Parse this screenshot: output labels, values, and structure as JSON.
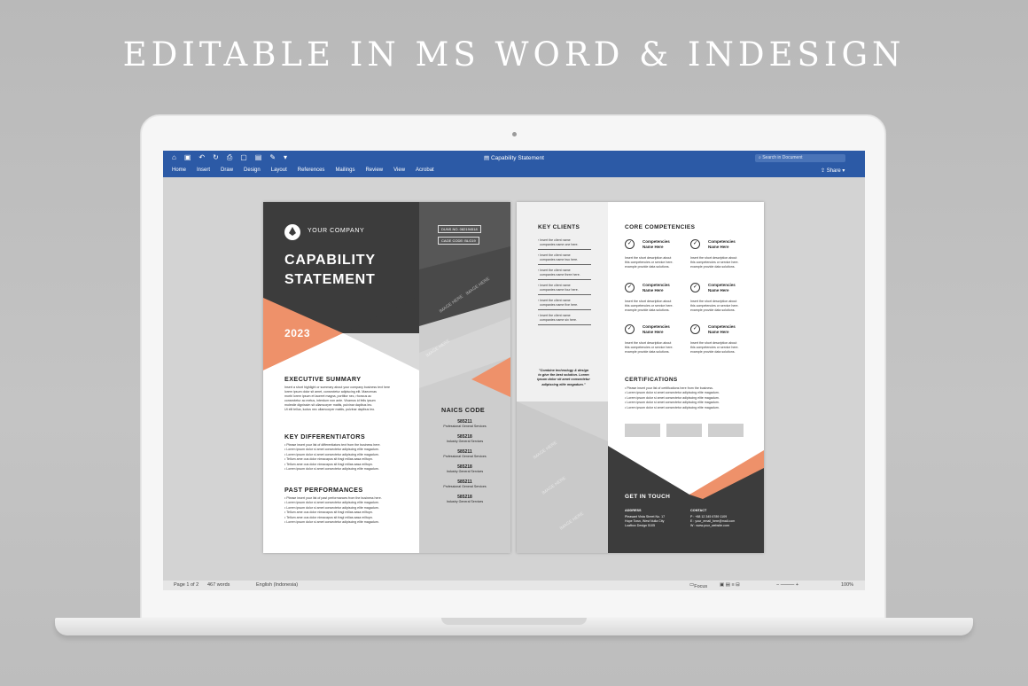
{
  "headline": "EDITABLE IN MS WORD & INDESIGN",
  "app": {
    "title": "Capability Statement",
    "search_placeholder": "Search in Document",
    "tabs": [
      "Home",
      "Insert",
      "Draw",
      "Design",
      "Layout",
      "References",
      "Mailings",
      "Review",
      "View",
      "Acrobat"
    ],
    "share_label": "Share",
    "quick_icons": [
      "home-icon",
      "save-icon",
      "undo-icon",
      "redo-icon",
      "print-icon",
      "new-doc-icon",
      "template-icon",
      "edit-icon",
      "more-icon"
    ]
  },
  "status": {
    "page": "Page 1 of 2",
    "words": "467 words",
    "language": "English (Indonesia)",
    "focus": "Focus",
    "zoom": "100%"
  },
  "page1": {
    "company": "YOUR COMPANY",
    "title_line1": "CAPABILITY",
    "title_line2": "STATEMENT",
    "year": "2023",
    "duns": "DUNS NO. 082194518",
    "cage": "CAGE CODE: BLG19",
    "exec_title": "EXECUTIVE SUMMARY",
    "exec_text": [
      "Insert a short highlight or summary about your company business text here",
      "lorem ipsum dolor sit amet, consectetur adipiscing elit. Maecenas",
      "morbi lorem ipsum et laoreet magna, porttitor nec, rhoncus ac",
      "consectetur ac metus, interdum non ante. Vivamus id felis ipsum",
      "molestie dignissim sit ullamcorper mattis, pulvinar dapibus leo.",
      "Ut elit tellus, luctus nec ullamcorper mattis, pulvinar dapibus leo."
    ],
    "diff_title": "KEY DIFFERENTIATORS",
    "diff_items": [
      "Please insert your list of differentiators text from the business here.",
      "Lorem ipsum dolor si amet consectetur adipiscing elite magadum.",
      "Lorem ipsum dolor si amet consectetur adipiscing elite magadum.",
      "Tellum ame ous dolor nimacapus sit fragl milias aasa miltopn.",
      "Tellum ame ous dolor nimacapus sit fragl milias aasa miltopn.",
      "Lorem ipsum dolor si amet consectetur adipiscing elite magadum."
    ],
    "past_title": "PAST PERFORMANCES",
    "past_items": [
      "Please insert your list of past performances from the business here.",
      "Lorem ipsum dolor si amet consectetur adipiscing elite magadum.",
      "Lorem ipsum dolor si amet consectetur adipiscing elite magadum.",
      "Tellum ame ous dolor nimacapus sit fragl milias aasa miltopn.",
      "Tellum ame ous dolor nimacapus sit fragl milias aasa miltopn.",
      "Lorem ipsum dolor si amet consectetur adipiscing elite magadum."
    ],
    "naics_title": "NAICS CODE",
    "naics": [
      {
        "code": "585211",
        "desc": "Professional General Services"
      },
      {
        "code": "585218",
        "desc": "Industry General Services"
      },
      {
        "code": "585211",
        "desc": "Professional General Services"
      },
      {
        "code": "585218",
        "desc": "Industry General Services"
      },
      {
        "code": "585211",
        "desc": "Professional General Services"
      },
      {
        "code": "585218",
        "desc": "Industry General Services"
      }
    ]
  },
  "page2": {
    "clients_title": "KEY CLIENTS",
    "clients": [
      [
        "Insert the client name",
        "companies name one here."
      ],
      [
        "Insert the client name",
        "companies name two here."
      ],
      [
        "Insert the client name",
        "companies name three here."
      ],
      [
        "Insert the client name",
        "companies name four here."
      ],
      [
        "Insert the client name",
        "companies name five here."
      ],
      [
        "Insert the client name",
        "companies name six here."
      ]
    ],
    "quote": [
      "\"Combine technology & design",
      "to give the best solution. Lorem",
      "ipsum dolor sit amet consectetur",
      "adipiscing elite megadum.\""
    ],
    "core_title": "CORE COMPETENCIES",
    "competencies": [
      {
        "name1": "Competencies",
        "name2": "Name Here",
        "desc": [
          "Insert the short description about",
          "this competencies or service here.",
          "example provide data solutions."
        ]
      },
      {
        "name1": "Competencies",
        "name2": "Name Here",
        "desc": [
          "Insert the short description about",
          "this competencies or service here.",
          "example provide data solutions."
        ]
      },
      {
        "name1": "Competencies",
        "name2": "Name Here",
        "desc": [
          "Insert the short description about",
          "this competencies or service here.",
          "example provide data solutions."
        ]
      },
      {
        "name1": "Competencies",
        "name2": "Name Here",
        "desc": [
          "Insert the short description about",
          "this competencies or service here.",
          "example provide data solutions."
        ]
      },
      {
        "name1": "Competencies",
        "name2": "Name Here",
        "desc": [
          "Insert the short description about",
          "this competencies or service here.",
          "example provide data solutions."
        ]
      },
      {
        "name1": "Competencies",
        "name2": "Name Here",
        "desc": [
          "Insert the short description about",
          "this competencies or service here.",
          "example provide data solutions."
        ]
      }
    ],
    "cert_title": "CERTIFICATIONS",
    "certs": [
      "Please insert your list of certifications here from the business.",
      "Lorem ipsum dolor si amet consectetur adipiscing elite magadum.",
      "Lorem ipsum dolor si amet consectetur adipiscing elite magadum.",
      "Lorem ipsum dolor si amet consectetur adipiscing elite magadum.",
      "Lorem ipsum dolor si amet consectetur adipiscing elite magadum."
    ],
    "touch_title": "GET IN TOUCH",
    "address_label": "ADDRESS",
    "address": [
      "Pleasant Vista Street No. 17",
      "Hope Town, West Nulla City",
      "Loafbox Design 5105"
    ],
    "contact_label": "CONTACT",
    "contact": [
      "P : +88 12 345 6789 1109",
      "E : your_email_here@mail.com",
      "W : www.your_website.com"
    ],
    "watermark": "IMAGE HERE"
  },
  "colors": {
    "accent": "#ee916a",
    "dark": "#3c3c3c",
    "ribbon": "#2c5aa6"
  }
}
